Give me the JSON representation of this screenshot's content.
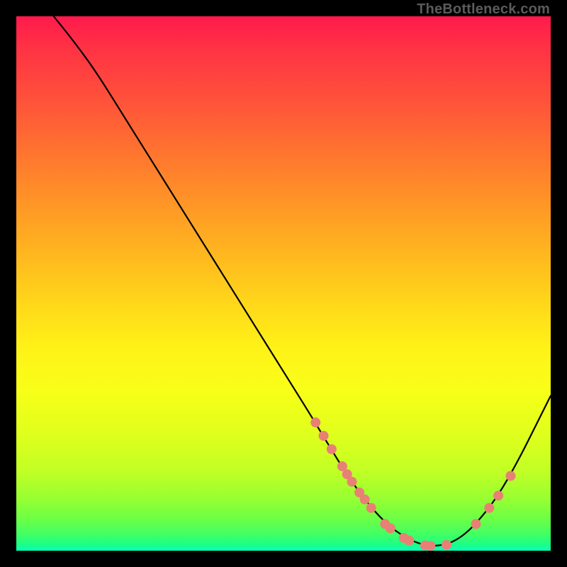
{
  "watermark": "TheBottleneck.com",
  "colors": {
    "background": "#000000",
    "curve": "#000000",
    "marker": "#e88076",
    "gradient_top": "#ff1a4d",
    "gradient_bottom": "#08ffc1"
  },
  "chart_data": {
    "type": "line",
    "title": "",
    "xlabel": "",
    "ylabel": "",
    "xlim": [
      0,
      100
    ],
    "ylim": [
      0,
      100
    ],
    "curve": [
      {
        "x": 7.0,
        "y": 100.0
      },
      {
        "x": 11.0,
        "y": 95.0
      },
      {
        "x": 15.0,
        "y": 89.5
      },
      {
        "x": 20.0,
        "y": 81.5
      },
      {
        "x": 25.0,
        "y": 73.5
      },
      {
        "x": 30.0,
        "y": 65.5
      },
      {
        "x": 35.0,
        "y": 57.5
      },
      {
        "x": 40.0,
        "y": 49.5
      },
      {
        "x": 45.0,
        "y": 41.5
      },
      {
        "x": 50.0,
        "y": 33.5
      },
      {
        "x": 55.0,
        "y": 25.5
      },
      {
        "x": 58.0,
        "y": 20.5
      },
      {
        "x": 62.0,
        "y": 14.0
      },
      {
        "x": 66.0,
        "y": 8.5
      },
      {
        "x": 70.0,
        "y": 4.3
      },
      {
        "x": 74.0,
        "y": 1.8
      },
      {
        "x": 77.0,
        "y": 0.9
      },
      {
        "x": 80.0,
        "y": 1.0
      },
      {
        "x": 83.0,
        "y": 2.3
      },
      {
        "x": 86.0,
        "y": 5.0
      },
      {
        "x": 90.0,
        "y": 10.0
      },
      {
        "x": 94.0,
        "y": 17.0
      },
      {
        "x": 98.0,
        "y": 25.0
      },
      {
        "x": 100.0,
        "y": 29.0
      }
    ],
    "markers": [
      {
        "x": 56.0,
        "y": 24.0
      },
      {
        "x": 57.5,
        "y": 21.5
      },
      {
        "x": 59.0,
        "y": 19.0
      },
      {
        "x": 61.0,
        "y": 15.8
      },
      {
        "x": 61.9,
        "y": 14.3
      },
      {
        "x": 62.8,
        "y": 12.9
      },
      {
        "x": 64.2,
        "y": 10.9
      },
      {
        "x": 65.2,
        "y": 9.6
      },
      {
        "x": 66.4,
        "y": 8.0
      },
      {
        "x": 69.0,
        "y": 5.0
      },
      {
        "x": 70.0,
        "y": 4.2
      },
      {
        "x": 72.5,
        "y": 2.4
      },
      {
        "x": 73.5,
        "y": 1.9
      },
      {
        "x": 76.5,
        "y": 1.0
      },
      {
        "x": 77.5,
        "y": 0.9
      },
      {
        "x": 80.5,
        "y": 1.1
      },
      {
        "x": 86.0,
        "y": 5.0
      },
      {
        "x": 88.5,
        "y": 8.0
      },
      {
        "x": 90.2,
        "y": 10.3
      },
      {
        "x": 92.5,
        "y": 14.0
      }
    ]
  }
}
